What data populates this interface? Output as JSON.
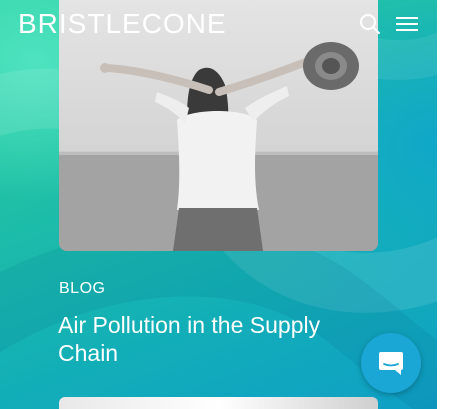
{
  "header": {
    "logo_text": "BRISTLECONE",
    "search_icon": "search-icon",
    "menu_icon": "menu-icon"
  },
  "post": {
    "category": "BLOG",
    "title": "Air Pollution in the Supply Chain"
  },
  "chat": {
    "icon": "chat-icon"
  },
  "colors": {
    "accent_green": "#2ed3a3",
    "accent_blue": "#0f9fc6",
    "chat_button": "#1aa7d6",
    "text": "#ffffff"
  }
}
